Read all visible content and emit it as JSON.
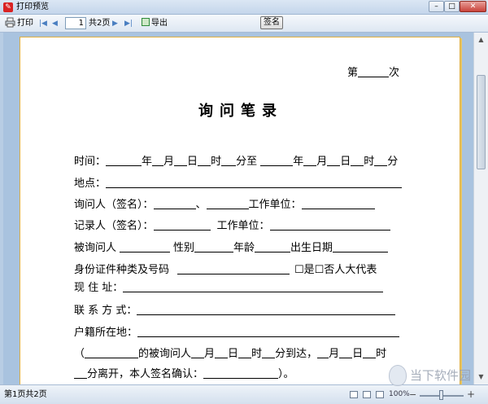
{
  "window": {
    "title": "打印预览",
    "icon_label": "✎"
  },
  "window_controls": {
    "minimize": "–",
    "maximize": "□",
    "close": "✕"
  },
  "toolbar": {
    "print_label": "打印",
    "page_value": "1",
    "page_total": "共2页",
    "export_label": "导出",
    "sign_label": "签名",
    "nav": {
      "first": "|◀",
      "prev": "◀",
      "next": "▶",
      "last": "▶|"
    }
  },
  "document": {
    "order_prefix": "第",
    "order_suffix": "次",
    "title": "询问笔录",
    "rows": {
      "time_label": "时间：",
      "year": "年",
      "month": "月",
      "day": "日",
      "hour": "时",
      "minute_to": "分至",
      "minute": "分",
      "place_label": "地点：",
      "asker_label": "询问人（签名）：",
      "separator": "、",
      "work_unit": "工作单位：",
      "recorder_label": "记录人（签名）：",
      "subject_label": "被询问人",
      "gender": "性别",
      "age": "年龄",
      "birth": "出生日期",
      "id_label": "身份证件种类及号码",
      "deputy_yes": "☐是",
      "deputy_no": "☐否人大代表",
      "address_label": "现 住 址：",
      "contact_label": "联 系 方 式：",
      "household_label": "户籍所在地：",
      "arrive_open": "（",
      "arrive_text": "的被询问人",
      "arrive_mid": "分到达，",
      "leave_text": "分离开，本人签名确认：",
      "leave_close": "）。"
    }
  },
  "statusbar": {
    "page_status": "第1页共2页",
    "zoom": "100%",
    "zoom_minus": "−",
    "zoom_plus": "+"
  },
  "scrollbar": {
    "up": "▲",
    "down": "▼"
  },
  "watermark": {
    "text": "当下软件园"
  }
}
